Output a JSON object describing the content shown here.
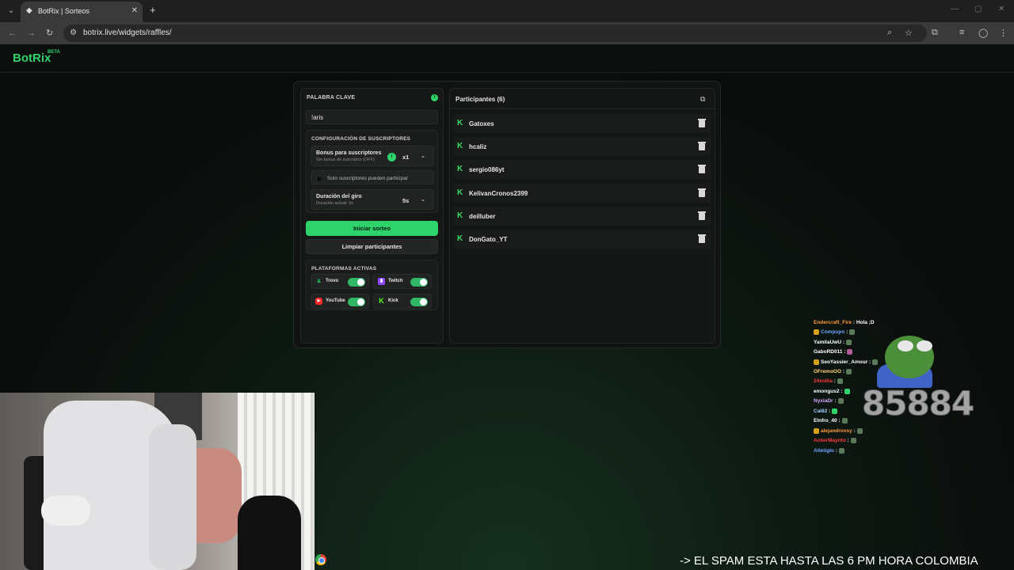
{
  "browser": {
    "tab_title": "BotRix | Sorteos",
    "url": "botrix.live/widgets/raffles/",
    "favicon": "botrix-icon",
    "close": "✕",
    "new_tab": "+"
  },
  "app": {
    "logo": "BotRix",
    "beta": "BETA"
  },
  "raffle": {
    "keyword_label": "PALABRA CLAVE",
    "keyword_value": "!aris",
    "subscribers_section": "CONFIGURACIÓN DE SUSCRIPTORES",
    "bonus_label": "Bonus para suscriptores",
    "bonus_sub": "Sin bonus de suscriptor (OFF)",
    "bonus_value": "x1",
    "only_subs_label": "Solo suscriptores pueden participar",
    "duration_label": "Duración del giro",
    "duration_sub": "Duración actual: 5s",
    "duration_value": "5s",
    "start_button": "Iniciar sorteo",
    "clear_button": "Limpiar participantes",
    "platforms_title": "PLATAFORMAS ACTIVAS",
    "platforms": [
      {
        "name": "Trovo",
        "enabled": true,
        "color": "#1ba34f"
      },
      {
        "name": "Twitch",
        "enabled": true,
        "color": "#9146ff"
      },
      {
        "name": "YouTube",
        "enabled": true,
        "color": "#ff2a2a"
      },
      {
        "name": "Kick",
        "enabled": true,
        "color": "#53fc18"
      }
    ]
  },
  "participants": {
    "title": "Participantes (6)",
    "items": [
      "Gatoxes",
      "hcaliz",
      "sergio086yt",
      "KelivanCronos2399",
      "deilluber",
      "DonGato_YT"
    ]
  },
  "chat": {
    "lines": [
      {
        "user": "Endercraft_Fire",
        "color": "#ff9a3c",
        "msg": ": Hola ;D"
      },
      {
        "user": "Compupo",
        "color": "#6aa8ff",
        "msg": ":"
      },
      {
        "user": "YamilaUwU",
        "color": "#ffffff",
        "msg": ":"
      },
      {
        "user": "GaboRD011",
        "color": "#ffffff",
        "msg": ":"
      },
      {
        "user": "SeoYassier_Amour",
        "color": "#ffffff",
        "msg": ":"
      },
      {
        "user": "OFremoOO",
        "color": "#ffd27a",
        "msg": ":"
      },
      {
        "user": "24xn0ia",
        "color": "#ff3c3c",
        "msg": ":"
      },
      {
        "user": "emongus2",
        "color": "#ffffff",
        "msg": ":"
      },
      {
        "user": "NyxiaDr",
        "color": "#d6a6ff",
        "msg": ":"
      },
      {
        "user": "Cal82",
        "color": "#9fd0ff",
        "msg": ":"
      },
      {
        "user": "Elnfro_40",
        "color": "#ffffff",
        "msg": ":"
      },
      {
        "user": "alejandroxsy",
        "color": "#ff9a3c",
        "msg": ":"
      },
      {
        "user": "AckerMaynto",
        "color": "#ff3c3c",
        "msg": ":"
      },
      {
        "user": "Atletiglo",
        "color": "#6aa8ff",
        "msg": ":"
      }
    ],
    "counter": "85884"
  },
  "ticker": "-> EL SPAM ESTA HASTA LAS 6 PM HORA COLOMBIA"
}
